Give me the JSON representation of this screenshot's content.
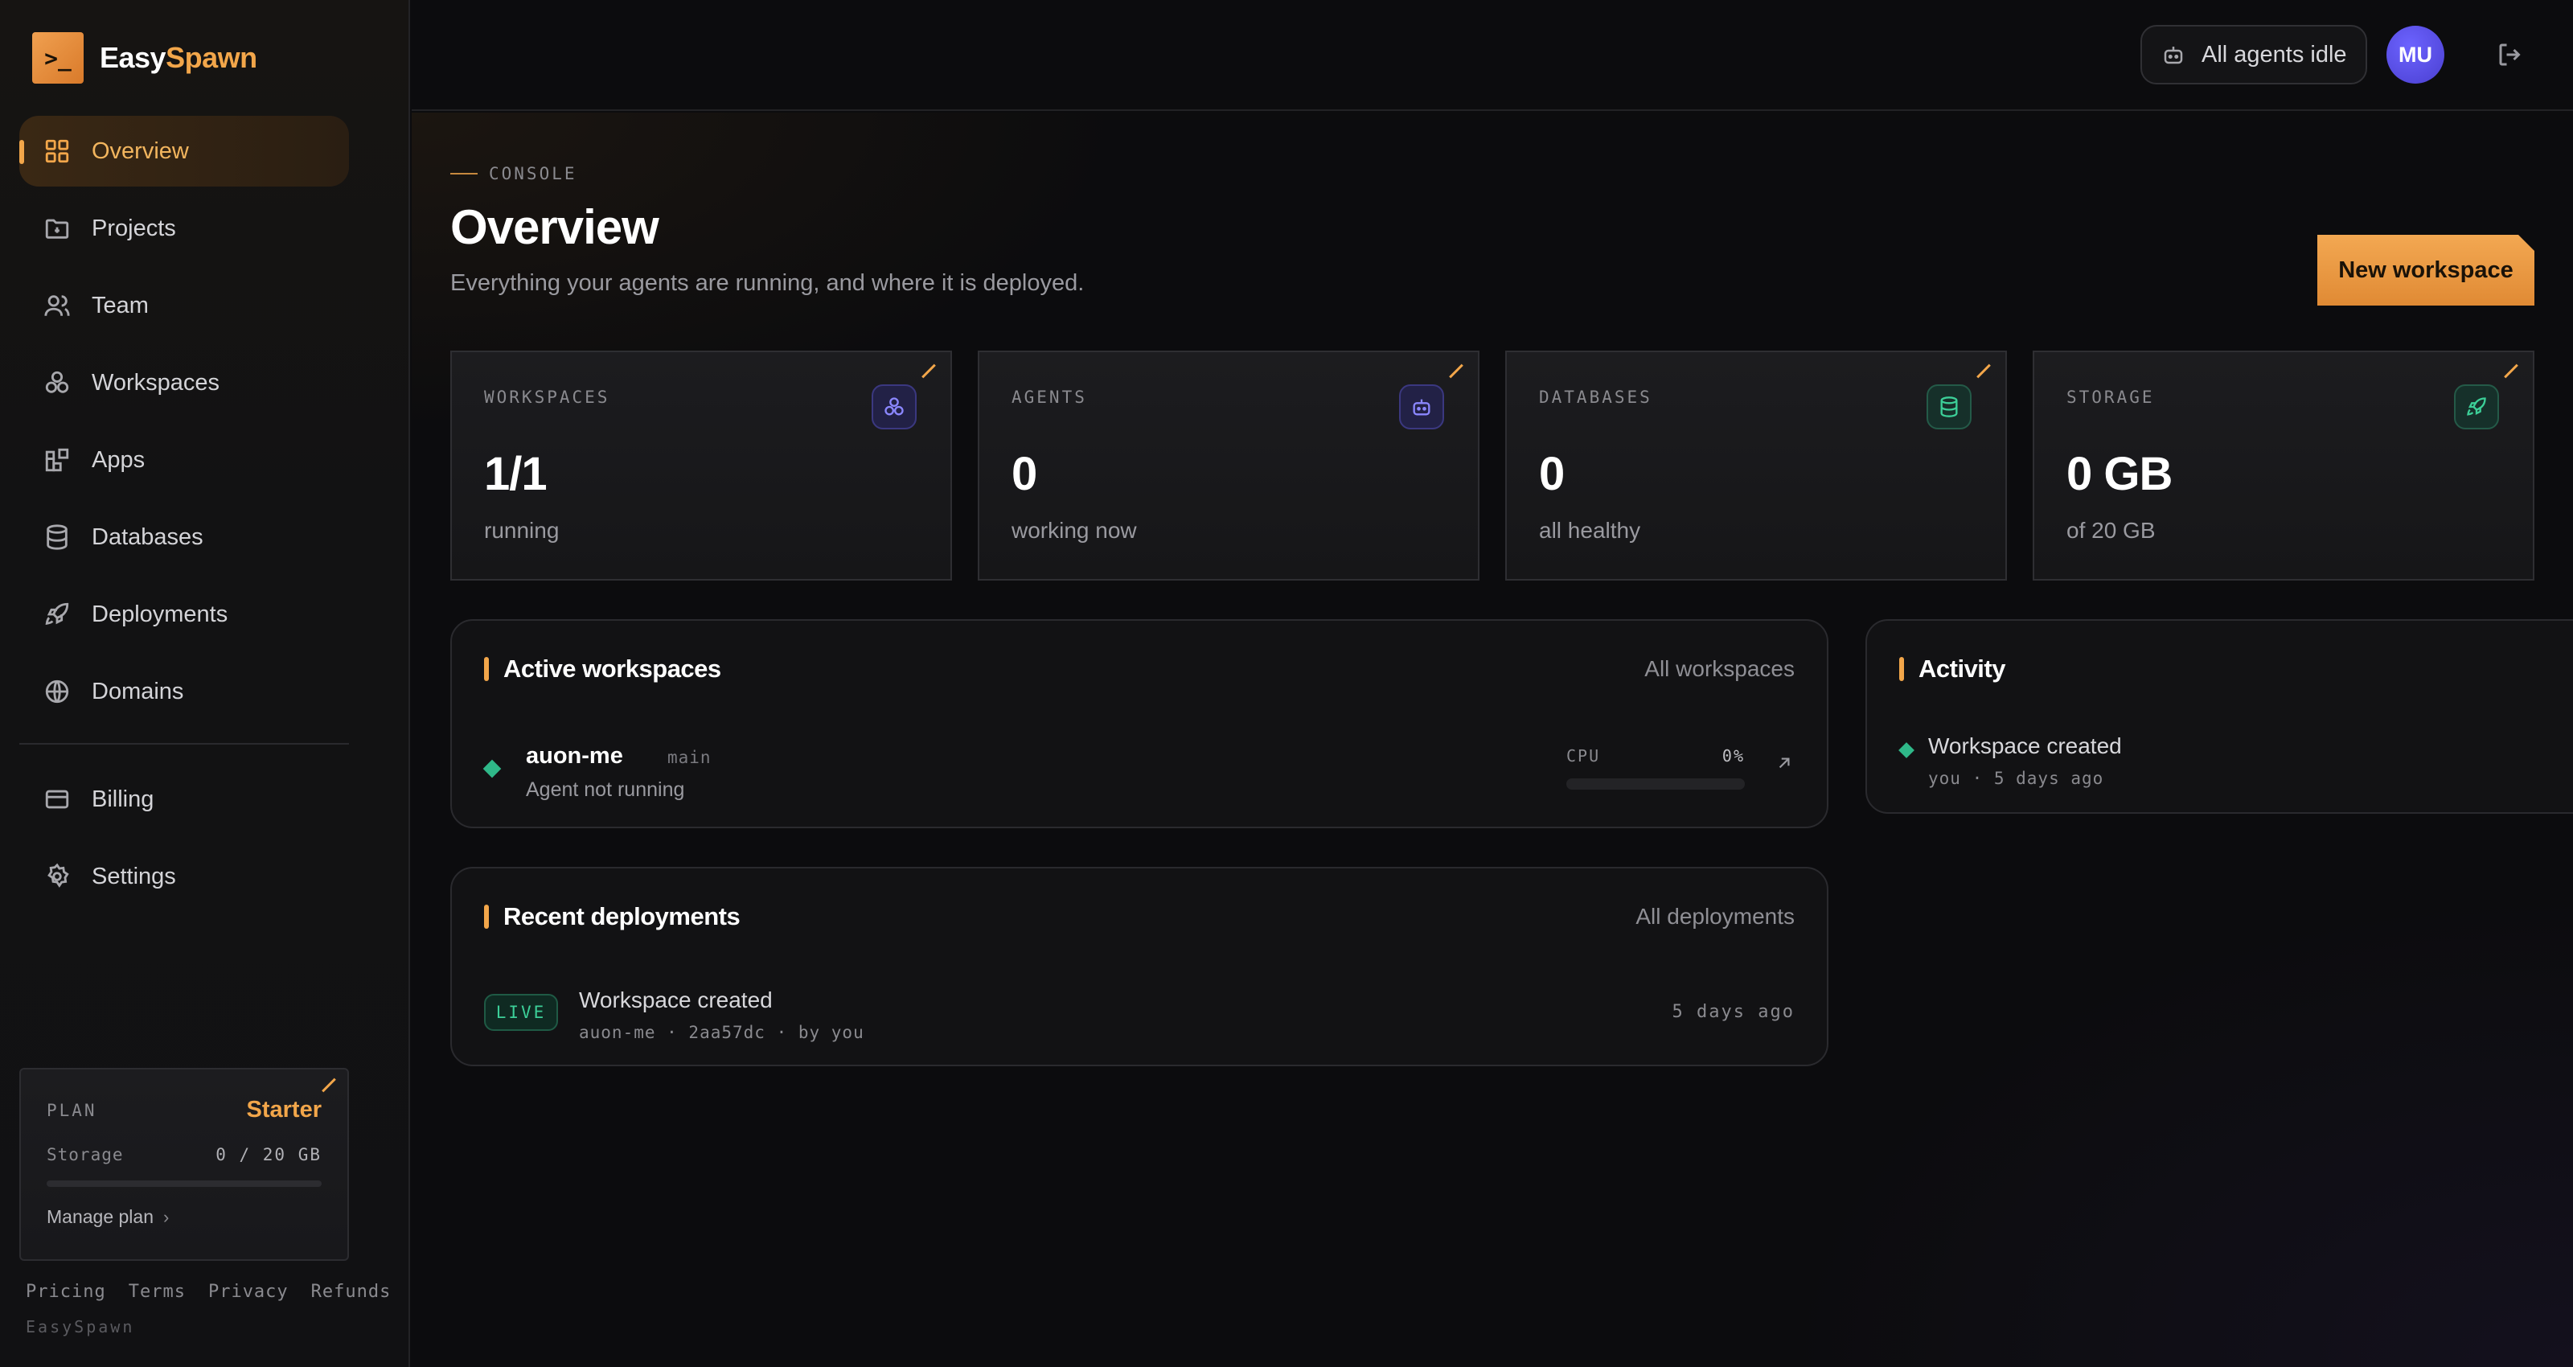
{
  "brand": {
    "logo_glyph": ">_",
    "name_part1": "Easy",
    "name_part2": "Spawn",
    "accent": "#f2a64a"
  },
  "sidebar": {
    "items": [
      {
        "label": "Overview",
        "icon": "grid-icon",
        "active": true
      },
      {
        "label": "Projects",
        "icon": "folder-icon",
        "active": false
      },
      {
        "label": "Team",
        "icon": "users-icon",
        "active": false
      },
      {
        "label": "Workspaces",
        "icon": "workspaces-icon",
        "active": false
      },
      {
        "label": "Apps",
        "icon": "apps-icon",
        "active": false
      },
      {
        "label": "Databases",
        "icon": "database-icon",
        "active": false
      },
      {
        "label": "Deployments",
        "icon": "rocket-icon",
        "active": false
      },
      {
        "label": "Domains",
        "icon": "globe-icon",
        "active": false
      }
    ],
    "secondary_items": [
      {
        "label": "Billing",
        "icon": "credit-card-icon"
      },
      {
        "label": "Settings",
        "icon": "gear-icon"
      }
    ],
    "plan": {
      "label": "PLAN",
      "name": "Starter",
      "storage_label": "Storage",
      "storage_value": "0 / 20 GB",
      "storage_fraction": 0,
      "manage_label": "Manage plan"
    },
    "footer_links": [
      "Pricing",
      "Terms",
      "Privacy",
      "Refunds"
    ],
    "footer_brand": "EasySpawn"
  },
  "topbar": {
    "status": "All agents idle",
    "status_icon": "bot-icon",
    "avatar_initials": "MU",
    "logout_icon": "logout-icon"
  },
  "page": {
    "eyebrow": "CONSOLE",
    "title": "Overview",
    "subtitle": "Everything your agents are running, and where it is deployed.",
    "primary_action": "New workspace"
  },
  "stats": [
    {
      "label": "WORKSPACES",
      "value": "1/1",
      "sub": "running",
      "icon": "workspaces-icon",
      "color": "#8b87ff"
    },
    {
      "label": "AGENTS",
      "value": "0",
      "sub": "working now",
      "icon": "bot-icon",
      "color": "#8b87ff"
    },
    {
      "label": "DATABASES",
      "value": "0",
      "sub": "all healthy",
      "icon": "database-icon",
      "color": "#3ccf98"
    },
    {
      "label": "STORAGE",
      "value": "0 GB",
      "sub": "of 20 GB",
      "icon": "rocket-icon",
      "color": "#3ccf98"
    }
  ],
  "active_workspaces": {
    "title": "Active workspaces",
    "link": "All workspaces",
    "rows": [
      {
        "name": "auon-me",
        "branch": "main",
        "status": "Agent not running",
        "cpu_label": "CPU",
        "cpu_value": "0%",
        "cpu_fraction": 0
      }
    ]
  },
  "activity": {
    "title": "Activity",
    "items": [
      {
        "title": "Workspace created",
        "meta": "you · 5 days ago"
      }
    ]
  },
  "recent_deployments": {
    "title": "Recent deployments",
    "link": "All deployments",
    "rows": [
      {
        "badge": "LIVE",
        "title": "Workspace created",
        "meta": "auon-me · 2aa57dc · by you",
        "time": "5 days ago"
      }
    ]
  }
}
